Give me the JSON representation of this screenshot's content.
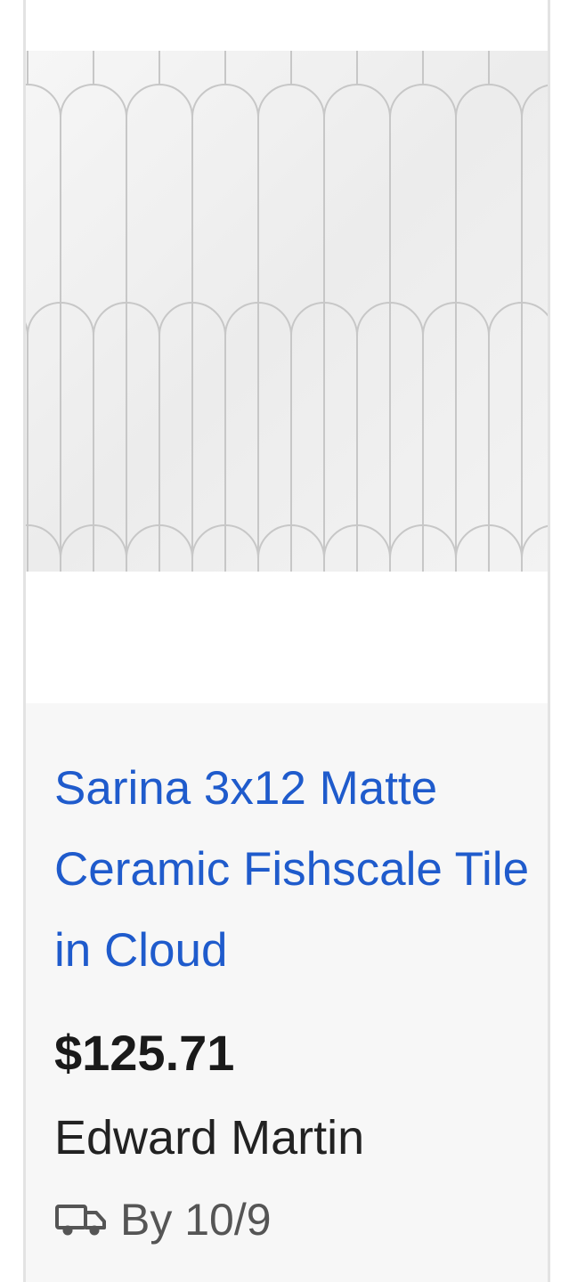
{
  "product": {
    "image_icon": "fishscale-tile-image",
    "title": "Sarina 3x12 Matte Ceramic Fishscale Tile in Cloud",
    "price": "$125.71",
    "seller": "Edward Martin",
    "delivery_icon": "truck-icon",
    "delivery_text": "By 10/9"
  },
  "colors": {
    "link": "#1f5bcc",
    "price": "#1a1a1a",
    "info_background": "#f7f7f7",
    "tile_surface": "#efefef",
    "tile_grout": "#c7c7c7"
  }
}
